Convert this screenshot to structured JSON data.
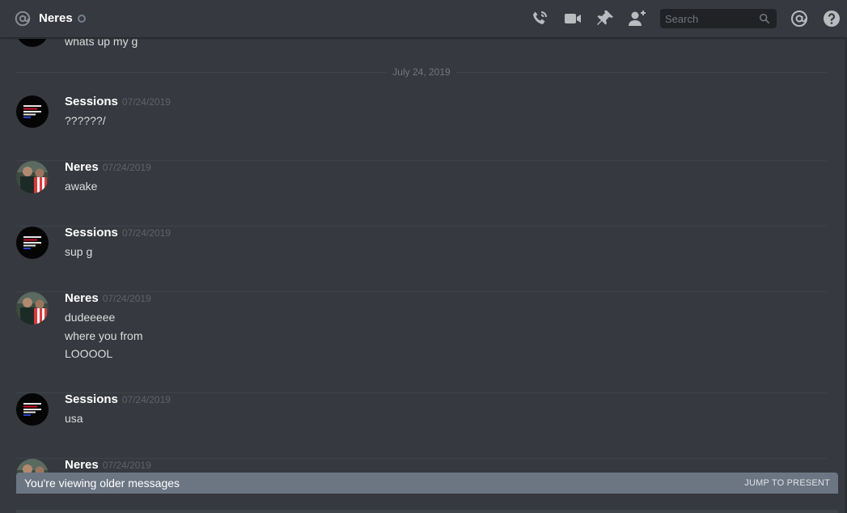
{
  "header": {
    "title": "Neres",
    "search_placeholder": "Search",
    "icons": [
      "at-icon",
      "call-icon",
      "video-icon",
      "pin-icon",
      "add-friend-icon",
      "search-icon",
      "mentions-icon",
      "help-icon"
    ],
    "status_color": "#747f8d"
  },
  "top_message": {
    "text": "whats up my g"
  },
  "date_divider": "July 24, 2019",
  "groups": [
    {
      "author": "Sessions",
      "timestamp": "07/24/2019",
      "avatar": "sessions-avatar",
      "lines": [
        "??????/"
      ]
    },
    {
      "author": "Neres",
      "timestamp": "07/24/2019",
      "avatar": "neres-avatar",
      "lines": [
        "awake"
      ]
    },
    {
      "author": "Sessions",
      "timestamp": "07/24/2019",
      "avatar": "sessions-avatar",
      "lines": [
        "sup g"
      ]
    },
    {
      "author": "Neres",
      "timestamp": "07/24/2019",
      "avatar": "neres-avatar",
      "lines": [
        "dudeeeee",
        "where you from",
        "LOOOOL"
      ]
    },
    {
      "author": "Sessions",
      "timestamp": "07/24/2019",
      "avatar": "sessions-avatar",
      "lines": [
        "usa"
      ]
    },
    {
      "author": "Neres",
      "timestamp": "07/24/2019",
      "avatar": "neres-avatar",
      "lines": []
    }
  ],
  "older_bar": {
    "text": "You're viewing older messages",
    "jump_label": "JUMP TO PRESENT",
    "color": "#6c7683"
  },
  "colors": {
    "background": "#36393f",
    "text": "#dcddde",
    "author": "#ffffff",
    "timestamp": "#5f6268"
  }
}
